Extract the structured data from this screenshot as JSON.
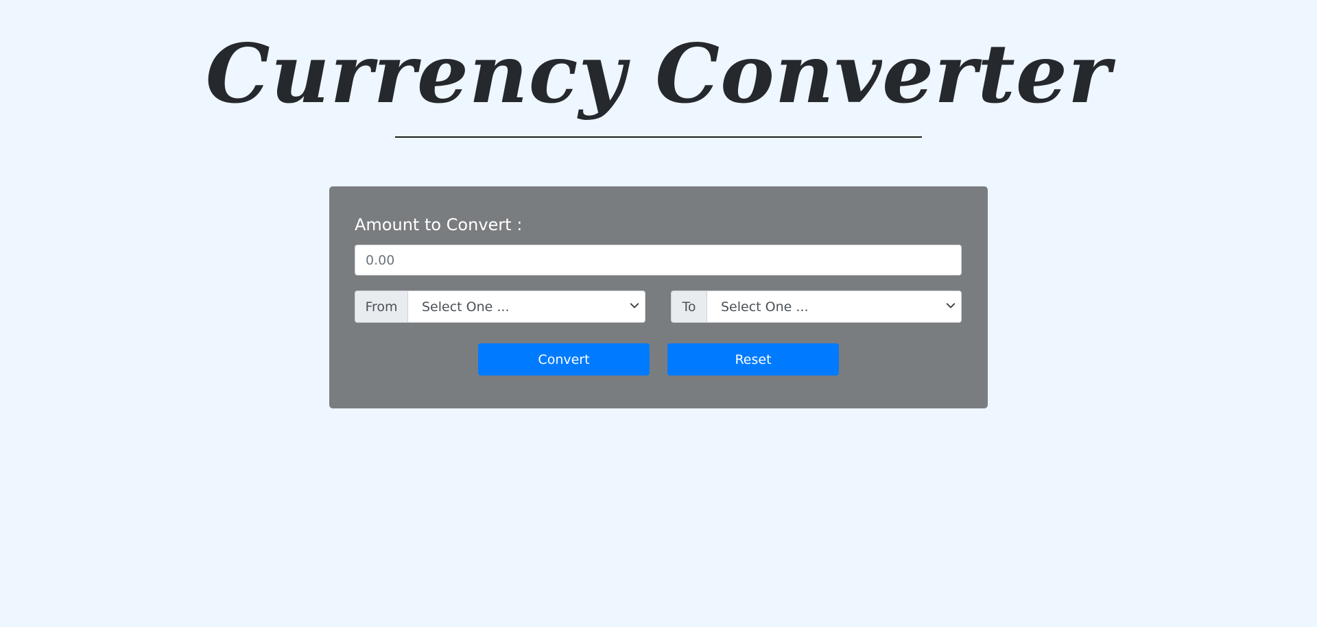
{
  "header": {
    "title": "Currency Converter"
  },
  "form": {
    "amount_label": "Amount to Convert :",
    "amount_placeholder": "0.00",
    "from": {
      "label": "From",
      "selected": "Select One ..."
    },
    "to": {
      "label": "To",
      "selected": "Select One ..."
    },
    "convert_label": "Convert",
    "reset_label": "Reset"
  },
  "colors": {
    "background": "#eef6ff",
    "card": "#7a7d80",
    "primary_button": "#007bff",
    "title": "#25282c"
  },
  "icons": {
    "select_arrow": "chevron-down-icon"
  }
}
